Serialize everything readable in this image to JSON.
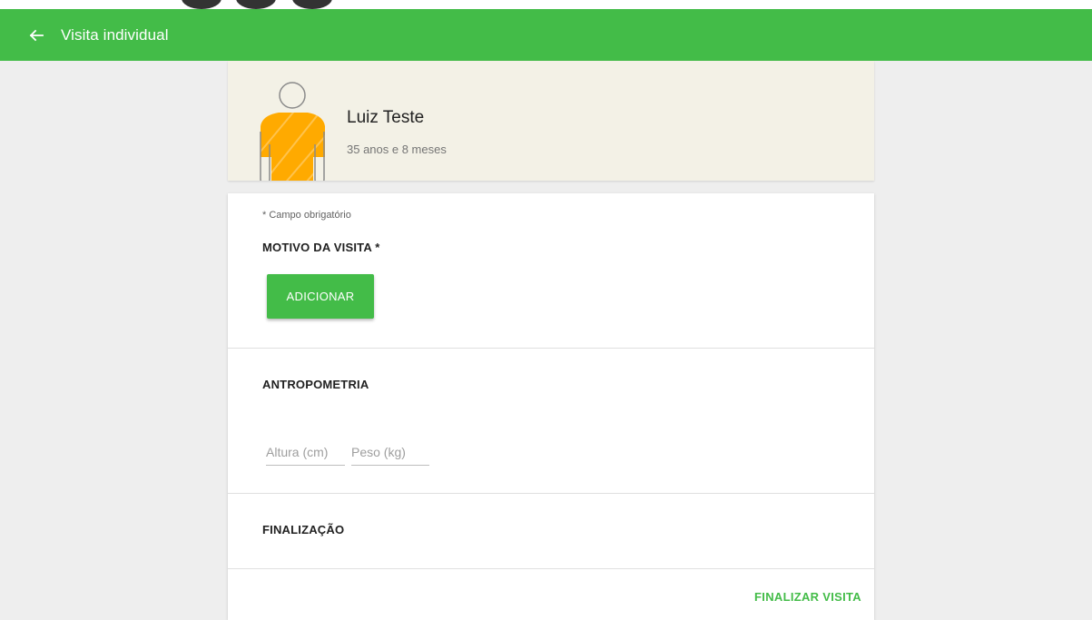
{
  "app_bar": {
    "title": "Visita individual",
    "back_icon": "arrow-left-icon"
  },
  "patient": {
    "name": "Luiz Teste",
    "age": "35 anos e 8 meses",
    "avatar_icon": "person-avatar-icon"
  },
  "form": {
    "required_note": "* Campo obrigatório",
    "reason": {
      "title": "MOTIVO DA VISITA *",
      "add_button_label": "ADICIONAR"
    },
    "anthropometry": {
      "title": "ANTROPOMETRIA",
      "height_placeholder": "Altura (cm)",
      "weight_placeholder": "Peso (kg)"
    },
    "finalization": {
      "title": "FINALIZAÇÃO"
    },
    "finalize_button_label": "FINALIZAR VISITA"
  },
  "colors": {
    "primary": "#43bc48",
    "header_background": "#f3f1e6",
    "avatar_shirt": "#ffaa00",
    "page_background": "#eeeeee"
  }
}
